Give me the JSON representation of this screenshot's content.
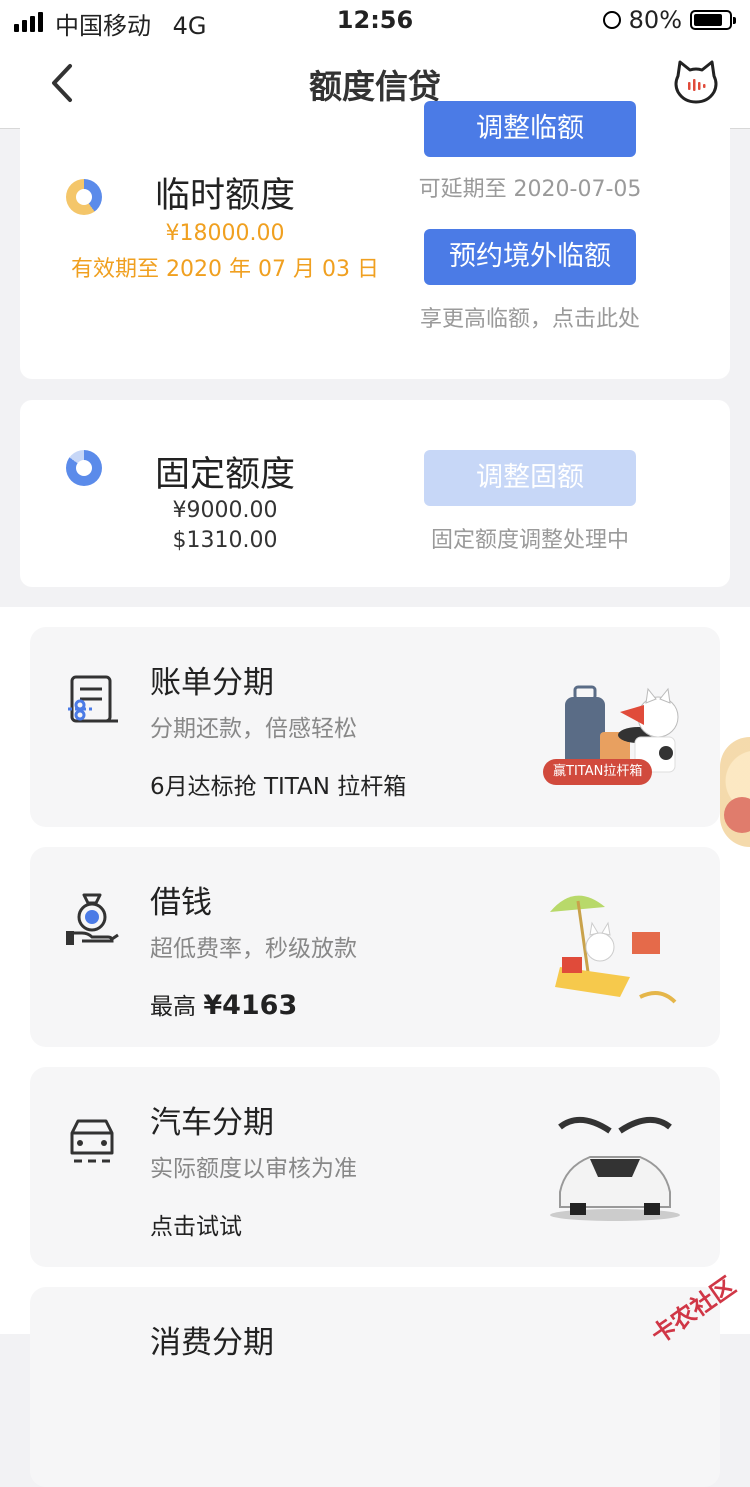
{
  "status": {
    "carrier": "中国移动",
    "network": "4G",
    "time": "12:56",
    "battery": "80%"
  },
  "nav": {
    "title": "额度信贷",
    "back_icon": "chevron-left-icon",
    "cat_icon": "cat-mascot-icon"
  },
  "temp_credit": {
    "title": "临时额度",
    "amount": "¥18000.00",
    "validity": "有效期至 2020 年 07 月 03 日",
    "adjust_button": "调整临额",
    "extend_hint": "可延期至 2020-07-05",
    "overseas_button": "预约境外临额",
    "overseas_hint": "享更高临额，点击此处"
  },
  "fixed_credit": {
    "title": "固定额度",
    "amount_cny": "¥9000.00",
    "amount_usd": "$1310.00",
    "adjust_button": "调整固额",
    "status_hint": "固定额度调整处理中"
  },
  "products": [
    {
      "title": "账单分期",
      "subtitle": "分期还款，倍感轻松",
      "extra": "6月达标抢 TITAN 拉杆箱",
      "badge": "赢TITAN拉杆箱",
      "icon": "bill-installment-icon"
    },
    {
      "title": "借钱",
      "subtitle": "超低费率，秒级放款",
      "extra_prefix": "最高",
      "extra_amount": "¥4163",
      "icon": "money-bag-icon"
    },
    {
      "title": "汽车分期",
      "subtitle": "实际额度以审核为准",
      "extra": "点击试试",
      "icon": "car-icon"
    },
    {
      "title": "消费分期"
    }
  ],
  "colors": {
    "primary": "#4b7be6",
    "orange": "#f0a020",
    "disabled": "#c7d7f7"
  },
  "watermark": "卡农社区"
}
